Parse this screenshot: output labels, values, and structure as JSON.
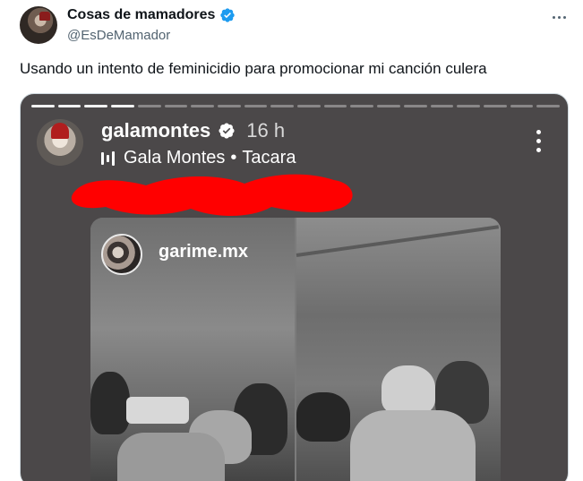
{
  "tweet": {
    "display_name": "Cosas de mamadores",
    "handle": "@EsDeMamador",
    "verified": true,
    "text": "Usando un intento de feminicidio para promocionar mi canción culera",
    "more_icon": "more-horizontal-icon"
  },
  "story": {
    "username": "galamontes",
    "time": "16 h",
    "music_artist": "Gala Montes",
    "music_separator": "•",
    "music_title": "Tacara",
    "menu_icon": "more-vertical-icon",
    "reposted_username": "garime.mx",
    "redaction_color": "#ff0000"
  },
  "colors": {
    "accent": "#1d9bf0",
    "text_primary": "#0f1419",
    "text_secondary": "#536471"
  }
}
